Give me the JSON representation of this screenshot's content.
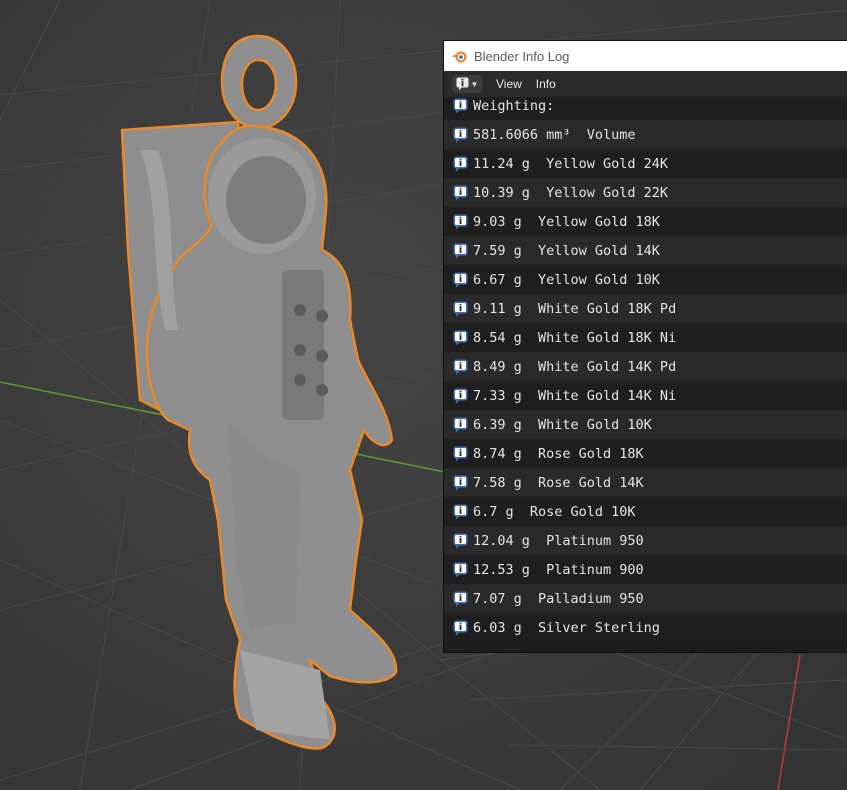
{
  "window": {
    "title": "Blender Info Log",
    "icon": "blender-icon"
  },
  "header": {
    "editor_type_icon": "info-icon",
    "menus": [
      "View",
      "Info"
    ]
  },
  "log": {
    "lines": [
      "Weighting:",
      "581.6066 mm³  Volume",
      "11.24 g  Yellow Gold 24K",
      "10.39 g  Yellow Gold 22K",
      "9.03 g  Yellow Gold 18K",
      "7.59 g  Yellow Gold 14K",
      "6.67 g  Yellow Gold 10K",
      "9.11 g  White Gold 18K Pd",
      "8.54 g  White Gold 18K Ni",
      "8.49 g  White Gold 14K Pd",
      "7.33 g  White Gold 14K Ni",
      "6.39 g  White Gold 10K",
      "8.74 g  Rose Gold 18K",
      "7.58 g  Rose Gold 14K",
      "6.7 g  Rose Gold 10K",
      "12.04 g  Platinum 950",
      "12.53 g  Platinum 900",
      "7.07 g  Palladium 950",
      "6.03 g  Silver Sterling"
    ],
    "line_icon": "info-icon"
  },
  "viewport": {
    "model": "astronaut pendant (selected)",
    "selection_outline_color": "#e88a2a",
    "x_axis_color": "#c0393b",
    "y_axis_color": "#5c9a34",
    "background_color": "#3d3d3d"
  }
}
